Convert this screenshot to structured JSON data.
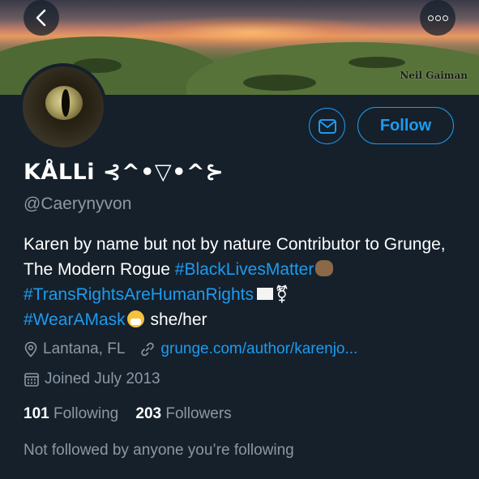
{
  "banner": {
    "watermark": "Neil Gaiman"
  },
  "nav": {
    "back_icon": "chevron-left-icon",
    "more_icon": "more-horizontal-icon"
  },
  "actions": {
    "message_icon": "envelope-icon",
    "follow_label": "Follow"
  },
  "profile": {
    "display_name": "KÅLLi ⊰^•▽•^⊱",
    "handle": "@Caerynyvon",
    "bio": {
      "text1": "Karen by name but not by nature Contributor to Grunge, The Modern Rogue ",
      "hashtag1": "#BlackLivesMatter",
      "hashtag2": "#TransRightsAreHumanRights",
      "trans_symbol": "⚧",
      "hashtag3": "#WearAMask",
      "pronouns": " she/her"
    },
    "location": "Lantana, FL",
    "website": "grunge.com/author/karenjo...",
    "joined": "Joined July 2013",
    "following_count": "101",
    "following_label": "Following",
    "followers_count": "203",
    "followers_label": "Followers",
    "not_followed": "Not followed by anyone you’re following"
  },
  "colors": {
    "background": "#15202b",
    "accent": "#1d9bf0",
    "secondary_text": "#8b98a5"
  }
}
